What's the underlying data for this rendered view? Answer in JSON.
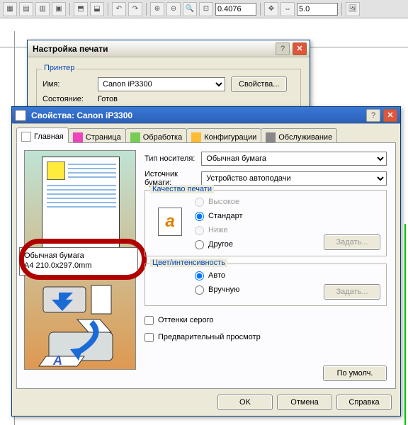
{
  "toolbar": {
    "zoom_value": "0.4076",
    "snap_value": "5.0"
  },
  "print_setup": {
    "title": "Настройка печати",
    "group": "Принтер",
    "name_label": "Имя:",
    "name_value": "Canon iP3300",
    "props_btn": "Свойства...",
    "status_label": "Состояние:",
    "status_value": "Готов"
  },
  "props": {
    "title": "Свойства: Canon iP3300",
    "tabs": {
      "main": "Главная",
      "page": "Страница",
      "effects": "Обработка",
      "config": "Конфигурации",
      "maint": "Обслуживание"
    },
    "media_label": "Тип носителя:",
    "media_value": "Обычная бумага",
    "source_label": "Источник бумаги:",
    "source_value": "Устройство автоподачи",
    "quality_group": "Качество печати",
    "quality": {
      "high": "Высокое",
      "standard": "Стандарт",
      "low": "Ниже",
      "other": "Другое"
    },
    "set_btn": "Задать...",
    "color_group": "Цвет/интенсивность",
    "color": {
      "auto": "Авто",
      "manual": "Вручную"
    },
    "gray": "Оттенки серого",
    "preview_check": "Предварительный просмотр",
    "defaults_btn": "По умолч.",
    "ok": "OK",
    "cancel": "Отмена",
    "help": "Справка",
    "info_line1": "Обычная бумага",
    "info_line2": "A4 210.0x297.0mm"
  }
}
